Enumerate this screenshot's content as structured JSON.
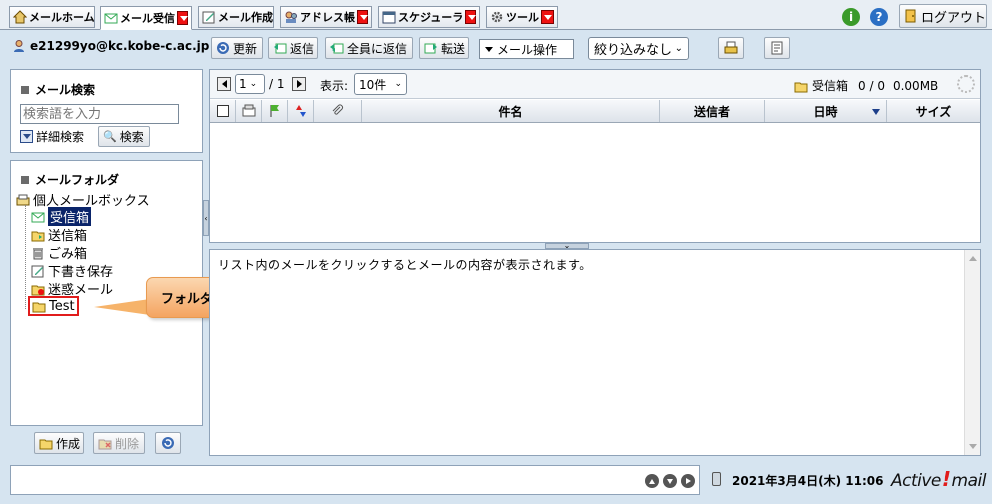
{
  "tabs": [
    {
      "label": "メールホーム"
    },
    {
      "label": "メール受信"
    },
    {
      "label": "メール作成"
    },
    {
      "label": "アドレス帳"
    },
    {
      "label": "スケジューラ"
    },
    {
      "label": "ツール"
    }
  ],
  "header": {
    "logout": "ログアウト"
  },
  "toolbar": {
    "user": "e21299yo@kc.kobe-c.ac.jp",
    "refresh": "更新",
    "reply": "返信",
    "reply_all": "全員に返信",
    "forward": "転送",
    "mail_ops": "メール操作",
    "filter": "絞り込みなし"
  },
  "search": {
    "title": "メール検索",
    "placeholder": "検索語を入力",
    "advanced": "詳細検索",
    "button": "検索"
  },
  "folders": {
    "title": "メールフォルダ",
    "root": "個人メールボックス",
    "items": [
      "受信箱",
      "送信箱",
      "ごみ箱",
      "下書き保存",
      "迷惑メール",
      "Test"
    ]
  },
  "callout": "フォルダが追加されたことを確認する",
  "folder_buttons": {
    "create": "作成",
    "delete": "削除"
  },
  "pager": {
    "page": "1",
    "total": "/ 1",
    "display_label": "表示:",
    "per_page": "10件"
  },
  "mailbox_status": {
    "folder": "受信箱",
    "count": "0 / 0",
    "size": "0.00MB"
  },
  "columns": {
    "subject": "件名",
    "sender": "送信者",
    "date": "日時",
    "size": "サイズ"
  },
  "preview": {
    "message": "リスト内のメールをクリックするとメールの内容が表示されます。"
  },
  "status": {
    "datetime": "2021年3月4日(木) 11:06",
    "brand_a": "Active",
    "brand_b": "mail"
  },
  "colors": {
    "accent_red": "#e11c1c",
    "selected_folder": "#0a246a",
    "panel_border": "#8ea2b8"
  }
}
